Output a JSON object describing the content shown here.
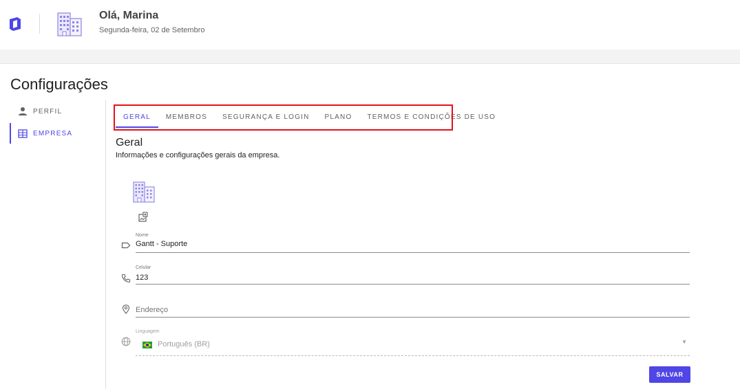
{
  "header": {
    "greeting": "Olá, Marina",
    "date": "Segunda-feira, 02 de Setembro"
  },
  "page_title": "Configurações",
  "sidebar": {
    "items": [
      {
        "label": "PERFIL",
        "icon": "person-icon",
        "active": false
      },
      {
        "label": "EMPRESA",
        "icon": "building-icon",
        "active": true
      }
    ]
  },
  "tabs": [
    {
      "label": "GERAL",
      "active": true
    },
    {
      "label": "MEMBROS",
      "active": false
    },
    {
      "label": "SEGURANÇA E LOGIN",
      "active": false
    },
    {
      "label": "PLANO",
      "active": false
    },
    {
      "label": "TERMOS E CONDIÇÕES DE USO",
      "active": false
    }
  ],
  "section": {
    "title": "Geral",
    "description": "Informações e configurações gerais da empresa."
  },
  "form": {
    "name": {
      "label": "Nome",
      "value": "Gantt - Suporte"
    },
    "phone": {
      "label": "Celular",
      "value": "123"
    },
    "address": {
      "placeholder": "Endereço",
      "value": ""
    },
    "language": {
      "label": "Linguagem",
      "value": "Português (BR)"
    }
  },
  "actions": {
    "save_label": "SALVAR"
  },
  "colors": {
    "accent": "#4f46e5",
    "highlight": "#e3111b"
  }
}
